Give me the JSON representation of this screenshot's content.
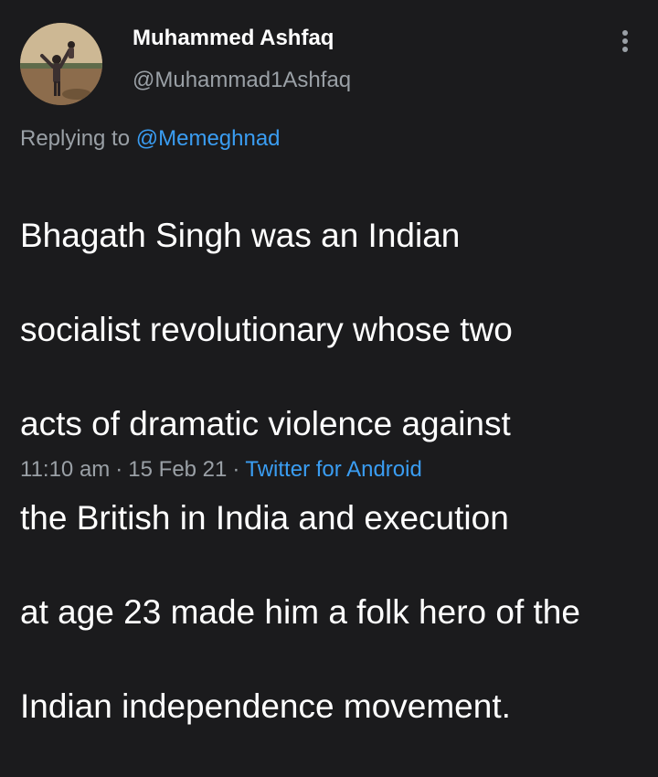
{
  "colors": {
    "background": "#1b1b1d",
    "primary_text": "#ffffff",
    "secondary_text": "#9aa0a6",
    "accent": "#3a9df2"
  },
  "author": {
    "display_name": "Muhammed Ashfaq",
    "handle": "@Muhammad1Ashfaq",
    "avatar_icon": "profile-photo"
  },
  "menu": {
    "icon": "vertical-ellipsis-icon"
  },
  "reply": {
    "prefix": "Replying to",
    "mention": "@Memeghnad"
  },
  "tweet": {
    "lines": [
      "Bhagath Singh was an Indian",
      "socialist revolutionary whose two",
      "acts of dramatic violence against",
      "the British in India and execution",
      "at age 23 made him a folk hero of the",
      "Indian independence movement."
    ]
  },
  "meta": {
    "time": "11:10 am",
    "separator": "·",
    "date": "15 Feb 21",
    "source": "Twitter for Android"
  }
}
